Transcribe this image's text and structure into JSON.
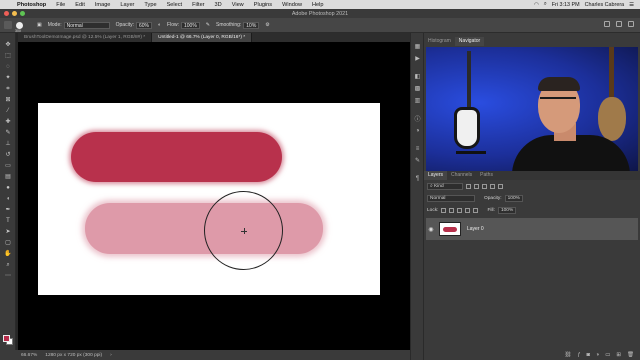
{
  "menubar": {
    "items": [
      "Photoshop",
      "File",
      "Edit",
      "Image",
      "Layer",
      "Type",
      "Select",
      "Filter",
      "3D",
      "View",
      "Plugins",
      "Window",
      "Help"
    ],
    "clock": "Fri 3:13 PM",
    "user": "Charles Cabrera"
  },
  "titlebar": {
    "title": "Adobe Photoshop 2021"
  },
  "options": {
    "brush_size": "300",
    "mode_label": "Mode:",
    "mode_value": "Normal",
    "opacity_label": "Opacity:",
    "opacity_value": "60%",
    "flow_label": "Flow:",
    "flow_value": "100%",
    "smoothing_label": "Smoothing:",
    "smoothing_value": "10%"
  },
  "doc_tabs": [
    {
      "label": "BrushToolDemoImage.psd @ 12.5% (Layer 1, RGB/8#) *"
    },
    {
      "label": "Untitled-1 @ 66.7% (Layer 0, RGB/16*) *"
    }
  ],
  "canvas": {
    "stroke_dark_color": "#b8314c",
    "stroke_light_color": "#de9aa9"
  },
  "status": {
    "zoom": "66.67%",
    "doc_info": "1280 px x 720 px (300 ppi)"
  },
  "panels": {
    "top_tabs": [
      "Histogram",
      "Navigator"
    ],
    "layer_tabs": [
      "Layers",
      "Channels",
      "Paths"
    ],
    "kind_label": "Kind",
    "blend_mode": "Normal",
    "opacity_label": "Opacity:",
    "opacity_value": "100%",
    "lock_label": "Lock:",
    "fill_label": "Fill:",
    "fill_value": "100%",
    "layer_name": "Layer 0"
  }
}
